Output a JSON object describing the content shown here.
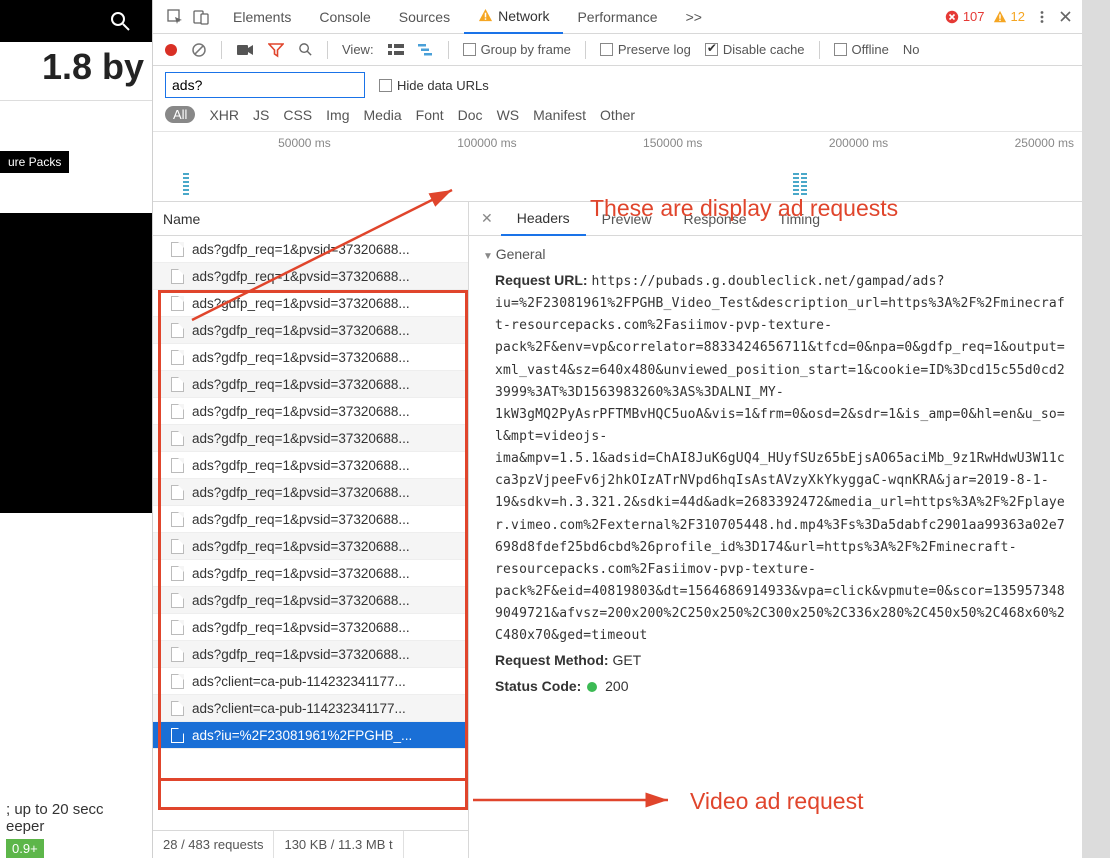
{
  "left": {
    "big_text": "1.8 by",
    "tag": "ure Packs",
    "bottom_line1": "; up to 20 secc",
    "bottom_line2": "eeper",
    "badge": "0.9+"
  },
  "devtools": {
    "tabs": [
      "Elements",
      "Console",
      "Sources",
      "Network",
      "Performance"
    ],
    "active_tab_index": 3,
    "more": ">>",
    "errors": 107,
    "warnings": 12
  },
  "toolbar": {
    "view": "View:",
    "group_by_frame": "Group by frame",
    "preserve_log": "Preserve log",
    "disable_cache": "Disable cache",
    "offline": "Offline",
    "no": "No"
  },
  "filter": {
    "value": "ads?",
    "hide_data_urls": "Hide data URLs"
  },
  "types": [
    "All",
    "XHR",
    "JS",
    "CSS",
    "Img",
    "Media",
    "Font",
    "Doc",
    "WS",
    "Manifest",
    "Other"
  ],
  "timeline": {
    "ticks": [
      "50000 ms",
      "100000 ms",
      "150000 ms",
      "200000 ms",
      "250000 ms"
    ]
  },
  "name_header": "Name",
  "requests": [
    "ads?gdfp_req=1&pvsid=37320688...",
    "ads?gdfp_req=1&pvsid=37320688...",
    "ads?gdfp_req=1&pvsid=37320688...",
    "ads?gdfp_req=1&pvsid=37320688...",
    "ads?gdfp_req=1&pvsid=37320688...",
    "ads?gdfp_req=1&pvsid=37320688...",
    "ads?gdfp_req=1&pvsid=37320688...",
    "ads?gdfp_req=1&pvsid=37320688...",
    "ads?gdfp_req=1&pvsid=37320688...",
    "ads?gdfp_req=1&pvsid=37320688...",
    "ads?gdfp_req=1&pvsid=37320688...",
    "ads?gdfp_req=1&pvsid=37320688...",
    "ads?gdfp_req=1&pvsid=37320688...",
    "ads?gdfp_req=1&pvsid=37320688...",
    "ads?gdfp_req=1&pvsid=37320688...",
    "ads?gdfp_req=1&pvsid=37320688...",
    "ads?client=ca-pub-114232341177...",
    "ads?client=ca-pub-114232341177...",
    "ads?iu=%2F23081961%2FPGHB_..."
  ],
  "selected_request_index": 18,
  "footer": {
    "count": "28 / 483 requests",
    "size": "130 KB / 11.3 MB t"
  },
  "detail": {
    "tabs": [
      "Headers",
      "Preview",
      "Response",
      "Timing"
    ],
    "active_index": 0,
    "general_label": "General",
    "request_url_label": "Request URL:",
    "request_url": "https://pubads.g.doubleclick.net/gampad/ads?iu=%2F23081961%2FPGHB_Video_Test&description_url=https%3A%2F%2Fminecraft-resourcepacks.com%2Fasiimov-pvp-texture-pack%2F&env=vp&correlator=8833424656711&tfcd=0&npa=0&gdfp_req=1&output=xml_vast4&sz=640x480&unviewed_position_start=1&cookie=ID%3Dcd15c55d0cd23999%3AT%3D1563983260%3AS%3DALNI_MY-1kW3gMQ2PyAsrPFTMBvHQC5uoA&vis=1&frm=0&osd=2&sdr=1&is_amp=0&hl=en&u_so=l&mpt=videojs-ima&mpv=1.5.1&adsid=ChAI8JuK6gUQ4_HUyfSUz65bEjsAO65aciMb_9z1RwHdwU3W11cca3pzVjpeeFv6j2hkOIzATrNVpd6hqIsAstAVzyXkYkyggaC-wqnKRA&jar=2019-8-1-19&sdkv=h.3.321.2&sdki=44d&adk=2683392472&media_url=https%3A%2F%2Fplayer.vimeo.com%2Fexternal%2F310705448.hd.mp4%3Fs%3Da5dabfc2901aa99363a02e7698d8fdef25bd6cbd%26profile_id%3D174&url=https%3A%2F%2Fminecraft-resourcepacks.com%2Fasiimov-pvp-texture-pack%2F&eid=40819803&dt=1564686914933&vpa=click&vpmute=0&scor=1359573489049721&afvsz=200x200%2C250x250%2C300x250%2C336x280%2C450x50%2C468x60%2C480x70&ged=timeout",
    "request_method_label": "Request Method:",
    "request_method": "GET",
    "status_code_label": "Status Code:",
    "status_code": "200"
  },
  "annotations": {
    "display_label": "These are display ad requests",
    "video_label": "Video ad request"
  }
}
